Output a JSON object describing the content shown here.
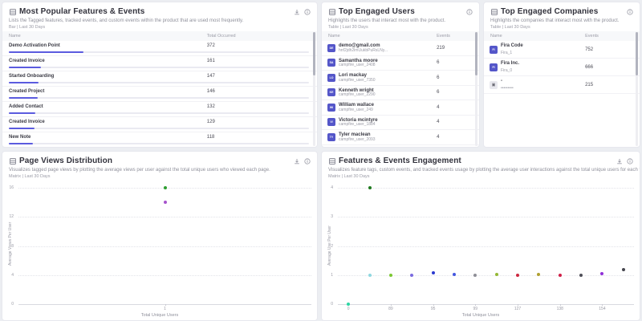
{
  "colors": {
    "accent_indigo": "#5b5bdf",
    "avatar_indigo": "#5456c9",
    "page_bg": "#eceef2",
    "panel_bg": "#ffffff",
    "muted_text": "#8f909b"
  },
  "icons": {
    "panel_glyph": "table-grid",
    "download_glyph": "download-arrow",
    "info_glyph": "i"
  },
  "panels": {
    "features": {
      "title": "Most Popular Features & Events",
      "subtitle": "Lists the Tagged features, tracked events, and custom events within the product that are used most frequently.",
      "meta": "Bar | Last 30 Days",
      "columns": {
        "name": "Name",
        "value": "Total Occurred"
      },
      "bar_scale_max": 1500,
      "rows": [
        {
          "name": "Demo Activation Point",
          "value": 372
        },
        {
          "name": "Created Invoice",
          "value": 161
        },
        {
          "name": "Started Onboarding",
          "value": 147
        },
        {
          "name": "Created Project",
          "value": 146
        },
        {
          "name": "Added Contact",
          "value": 132
        },
        {
          "name": "Created Invoice",
          "value": 129
        },
        {
          "name": "New Note",
          "value": 118
        }
      ]
    },
    "users": {
      "title": "Top Engaged Users",
      "subtitle": "Highlights the users that interact most with the product.",
      "meta": "Table | Last 30 Days",
      "columns": {
        "name": "Name",
        "value": "Events"
      },
      "rows": [
        {
          "name": "demo@gmail.com",
          "sub": "hnf2jdh2lmUukbPuRsLNy...",
          "initials": "DE",
          "events": "219"
        },
        {
          "name": "Samantha moore",
          "sub": "campfire_user_2408",
          "initials": "SA",
          "events": "6"
        },
        {
          "name": "Lori mackay",
          "sub": "campfire_user_7350",
          "initials": "LO",
          "events": "6"
        },
        {
          "name": "Kenneth wright",
          "sub": "campfire_user_2290",
          "initials": "KE",
          "events": "6"
        },
        {
          "name": "William wallace",
          "sub": "campfire_user_249",
          "initials": "WI",
          "events": "4"
        },
        {
          "name": "Victoria mcintyre",
          "sub": "campfire_user_1884",
          "initials": "VI",
          "events": "4"
        },
        {
          "name": "Tyler maclean",
          "sub": "campfire_user_2093",
          "initials": "TY",
          "events": "4"
        }
      ]
    },
    "companies": {
      "title": "Top Engaged Companies",
      "subtitle": "Highlights the companies that interact most with the product.",
      "meta": "Table | Last 30 Days",
      "columns": {
        "name": "Name",
        "value": "Events"
      },
      "rows": [
        {
          "name": "Fira Code",
          "sub": "Fira_1",
          "initials": "FI",
          "events": "752",
          "placeholder": false
        },
        {
          "name": "Fira Inc.",
          "sub": "Fira_0",
          "initials": "FI",
          "events": "666",
          "placeholder": false
        },
        {
          "name": "-",
          "sub": "•••••••••",
          "initials": "▣",
          "events": "215",
          "placeholder": true
        }
      ]
    },
    "page_views": {
      "title": "Page Views Distribution",
      "subtitle": "Visualizes tagged page views by plotting the average views per user against the total unique users who viewed each page.",
      "meta": "Matrix | Last 30 Days"
    },
    "engagement": {
      "title": "Features & Events Engagement",
      "subtitle": "Visualizes feature tags, custom events, and tracked events usage by plotting the average user interactions against the total unique users for each feature or event.",
      "meta": "Matrix | Last 30 Days"
    }
  },
  "chart_data": [
    {
      "id": "page_views",
      "type": "scatter",
      "title": "Page Views Distribution",
      "xlabel": "Total Unique Users",
      "ylabel": "Average Views Per User",
      "ylim": [
        0,
        16.8
      ],
      "yticks": [
        0,
        4,
        8,
        12,
        16
      ],
      "categories": [
        "1"
      ],
      "grid": "dotted-horizontal",
      "points": [
        {
          "ci": 0,
          "y": 16,
          "color": "#2e9e30",
          "size": 4
        },
        {
          "ci": 0,
          "y": 14,
          "color": "#a653cc",
          "size": 4
        }
      ]
    },
    {
      "id": "engagement",
      "type": "scatter",
      "title": "Features & Events Engagement",
      "xlabel": "Total Unique Users",
      "ylabel": "Average Use Per User",
      "ylim": [
        0,
        4.2
      ],
      "yticks": [
        0,
        1,
        2,
        3,
        4
      ],
      "categories": [
        "0",
        "",
        "89",
        "",
        "95",
        "",
        "99",
        "",
        "127",
        "",
        "138",
        "",
        "154",
        ""
      ],
      "grid": "dotted-horizontal",
      "points": [
        {
          "ci": 0,
          "y": 0,
          "color": "#2dd6a4",
          "size": 4
        },
        {
          "ci": 1,
          "y": 4,
          "color": "#1f7a1f",
          "size": 4
        },
        {
          "ci": 1,
          "y": 1,
          "color": "#8fd8e0",
          "size": 4
        },
        {
          "ci": 2,
          "y": 1,
          "color": "#7cc832",
          "size": 4
        },
        {
          "ci": 3,
          "y": 1,
          "color": "#7b6be0",
          "size": 4
        },
        {
          "ci": 4,
          "y": 1.07,
          "color": "#2b3ad0",
          "size": 4
        },
        {
          "ci": 5,
          "y": 1.03,
          "color": "#4457e0",
          "size": 4
        },
        {
          "ci": 6,
          "y": 1,
          "color": "#8e8e96",
          "size": 4
        },
        {
          "ci": 7,
          "y": 1.02,
          "color": "#94b834",
          "size": 4
        },
        {
          "ci": 8,
          "y": 1,
          "color": "#cc2840",
          "size": 4
        },
        {
          "ci": 9,
          "y": 1.03,
          "color": "#b0a030",
          "size": 4
        },
        {
          "ci": 10,
          "y": 1,
          "color": "#d01f48",
          "size": 4
        },
        {
          "ci": 11,
          "y": 1,
          "color": "#4f4f58",
          "size": 4
        },
        {
          "ci": 12,
          "y": 1.06,
          "color": "#9030d8",
          "size": 4
        },
        {
          "ci": 13,
          "y": 1.2,
          "color": "#45454e",
          "size": 4
        }
      ]
    }
  ]
}
